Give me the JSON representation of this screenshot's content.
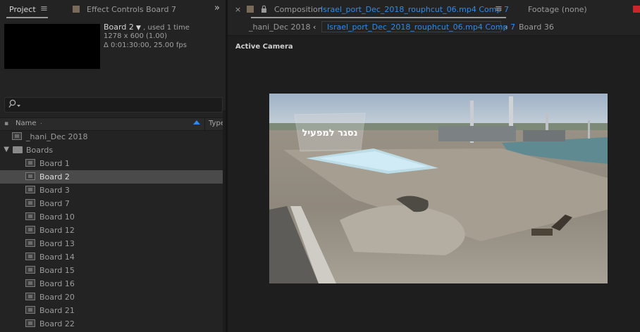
{
  "top": {
    "project_tab": "Project",
    "effect_controls_tab": "Effect Controls Board 7",
    "expand_glyph": "»",
    "close_glyph": "×",
    "composition_prefix": "Composition",
    "composition_name": "Israel_port_Dec_2018_rouphcut_06.mp4 Comp 7",
    "footage_tab": "Footage (none)"
  },
  "project": {
    "item_name": "Board 2",
    "item_used": ", used 1 time",
    "dimensions": "1278 x 600 (1.00)",
    "duration": "Δ 0:01:30:00, 25.00 fps",
    "search_placeholder": "",
    "col_name": "Name",
    "col_type": "Type",
    "items": [
      {
        "name": "_hani_Dec 2018",
        "kind": "comp",
        "indent": 0
      },
      {
        "name": "Boards",
        "kind": "folder",
        "indent": 0
      },
      {
        "name": "Board 1",
        "kind": "comp",
        "indent": 1
      },
      {
        "name": "Board 2",
        "kind": "comp",
        "indent": 1,
        "selected": true
      },
      {
        "name": "Board 3",
        "kind": "comp",
        "indent": 1
      },
      {
        "name": "Board 7",
        "kind": "comp",
        "indent": 1
      },
      {
        "name": "Board 10",
        "kind": "comp",
        "indent": 1
      },
      {
        "name": "Board 12",
        "kind": "comp",
        "indent": 1
      },
      {
        "name": "Board 13",
        "kind": "comp",
        "indent": 1
      },
      {
        "name": "Board 14",
        "kind": "comp",
        "indent": 1
      },
      {
        "name": "Board 15",
        "kind": "comp",
        "indent": 1
      },
      {
        "name": "Board 16",
        "kind": "comp",
        "indent": 1
      },
      {
        "name": "Board 20",
        "kind": "comp",
        "indent": 1
      },
      {
        "name": "Board 21",
        "kind": "comp",
        "indent": 1
      },
      {
        "name": "Board 22",
        "kind": "comp",
        "indent": 1
      }
    ]
  },
  "viewer": {
    "subtab_1": "_hani_Dec 2018",
    "subtab_active": "Israel_port_Dec_2018_rouphcut_06.mp4 Comp 7",
    "subtab_3": "Board 36",
    "camera_label": "Active Camera",
    "sign_text": "נסגר למפעיל"
  },
  "colors": {
    "accent_blue": "#2d8ceb",
    "selected_row": "#4a4a4a"
  }
}
